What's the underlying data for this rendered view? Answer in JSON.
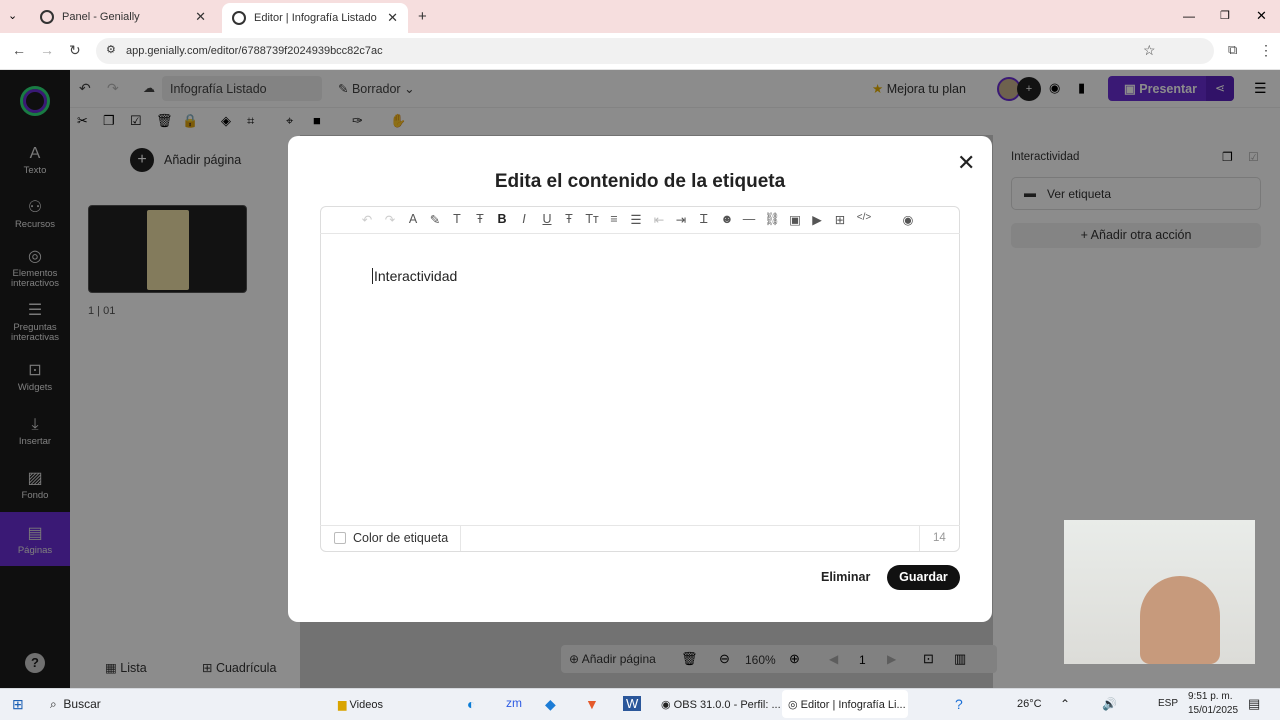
{
  "browser": {
    "tabs": [
      {
        "label": "Panel - Genially"
      },
      {
        "label": "Editor | Infografía Listado"
      }
    ],
    "url": "app.genially.com/editor/6788739f2024939bcc82c7ac"
  },
  "app": {
    "title": "Infografía Listado",
    "draft_label": "Borrador",
    "upgrade_label": "Mejora tu plan",
    "present_label": "Presentar",
    "add_page_label": "Añadir página",
    "page_number": "1",
    "page_name": "01",
    "list_label": "Lista",
    "grid_label": "Cuadrícula",
    "zoom": "160%",
    "current_page": "1",
    "bottom_add_page": "Añadir página"
  },
  "leftnav": [
    {
      "label": "Texto",
      "icon": "text-icon"
    },
    {
      "label": "Recursos",
      "icon": "resources-icon"
    },
    {
      "label": "Elementos interactivos",
      "icon": "interactive-icon"
    },
    {
      "label": "Preguntas interactivas",
      "icon": "questions-icon"
    },
    {
      "label": "Widgets",
      "icon": "widgets-icon"
    },
    {
      "label": "Insertar",
      "icon": "insert-icon"
    },
    {
      "label": "Fondo",
      "icon": "background-icon"
    },
    {
      "label": "Páginas",
      "icon": "pages-icon"
    }
  ],
  "rightpanel": {
    "title": "Interactividad",
    "view_label": "Ver etiqueta",
    "add_action": "Añadir otra acción"
  },
  "modal": {
    "title": "Edita el contenido de la etiqueta",
    "content": "Interactividad",
    "color_label": "Color de etiqueta",
    "char_count": "14",
    "delete_label": "Eliminar",
    "save_label": "Guardar"
  },
  "taskbar": {
    "search": "Buscar",
    "items": [
      "Videos",
      "OBS 31.0.0 - Perfil: ...",
      "Editor | Infografía Li..."
    ],
    "temperature": "26°C",
    "lang": "ESP",
    "time": "9:51 p. m.",
    "date": "15/01/2025"
  }
}
